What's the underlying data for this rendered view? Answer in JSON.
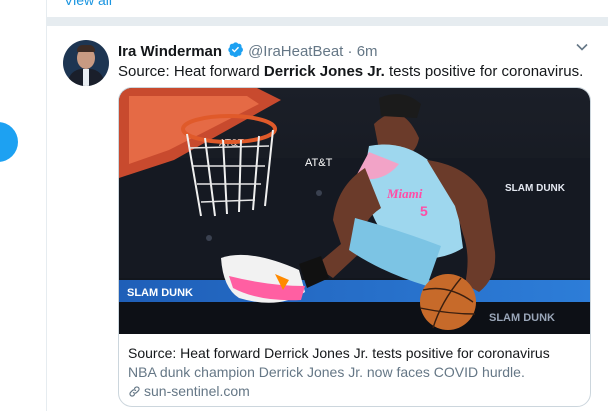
{
  "timeline": {
    "view_all_label": "View all"
  },
  "tweet": {
    "author_name": "Ira Winderman",
    "handle": "@IraHeatBeat",
    "dot": "·",
    "time": "6m",
    "text_prefix": "Source: Heat forward ",
    "text_bold": "Derrick Jones Jr.",
    "text_suffix": " tests positive for coronavirus.",
    "icons": [
      "verified-badge-icon",
      "chevron-down-icon",
      "link-icon"
    ]
  },
  "card": {
    "title": "Source: Heat forward Derrick Jones Jr. tests positive for coronavirus",
    "description": "NBA dunk champion Derrick Jones Jr. now faces COVID hurdle.",
    "domain": "sun-sentinel.com",
    "photo_texts": {
      "backboard_brand": "AT&T",
      "court_brand": "AT&T",
      "ad_board_left": "SLAM DUNK",
      "ad_board_right": "SLAM DUNK",
      "banner_right": "SLAM DUNK",
      "jersey_text": "Miami",
      "jersey_number": "5"
    }
  },
  "colors": {
    "accent": "#1da1f2",
    "link": "#1b95e0",
    "secondary_text": "#657786",
    "border": "#ccd6dd"
  }
}
